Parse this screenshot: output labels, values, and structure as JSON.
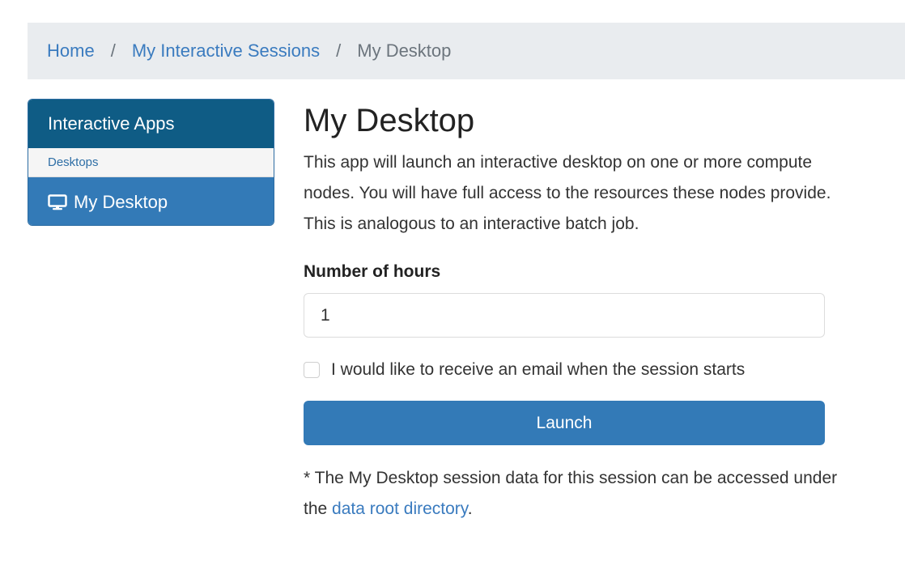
{
  "breadcrumb": {
    "home": "Home",
    "separator": "/",
    "sessions": "My Interactive Sessions",
    "current": "My Desktop"
  },
  "sidebar": {
    "header": "Interactive Apps",
    "category": "Desktops",
    "items": [
      {
        "label": "My Desktop",
        "icon": "monitor-icon"
      }
    ]
  },
  "main": {
    "title": "My Desktop",
    "description": "This app will launch an interactive desktop on one or more compute nodes. You will have full access to the resources these nodes provide. This is analogous to an interactive batch job.",
    "hours_label": "Number of hours",
    "hours_value": "1",
    "email_checkbox_label": "I would like to receive an email when the session starts",
    "launch_label": "Launch",
    "note_prefix": "* The My Desktop session data for this session can be accessed under the ",
    "note_link": "data root directory",
    "note_suffix": "."
  },
  "colors": {
    "primary": "#337ab7",
    "sidebar_header": "#0f5c85",
    "link": "#3a7bbf",
    "breadcrumb_bg": "#e9ecef"
  }
}
